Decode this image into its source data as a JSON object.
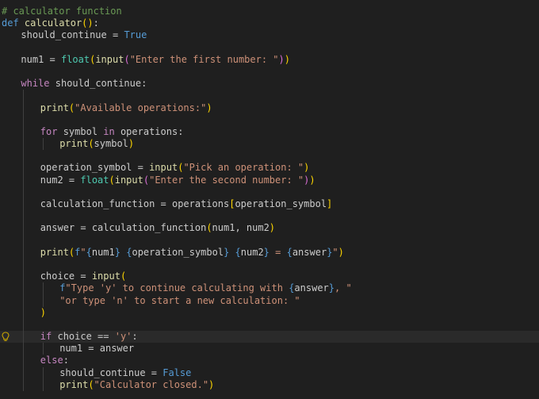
{
  "editor": {
    "background": "#1f1f1f",
    "current_line_background": "#2a2a2a",
    "indent_guide_color": "#404040",
    "lightbulb_line": 27,
    "current_line": 27,
    "lines": [
      {
        "indent": 0,
        "tokens": [
          {
            "t": "comment",
            "v": "# calculator function"
          }
        ]
      },
      {
        "indent": 0,
        "tokens": [
          {
            "t": "keyword",
            "v": "def"
          },
          {
            "t": "plain",
            "v": " "
          },
          {
            "t": "function",
            "v": "calculator"
          },
          {
            "t": "bracket1",
            "v": "()"
          },
          {
            "t": "plain",
            "v": ":"
          }
        ]
      },
      {
        "indent": 1,
        "tokens": [
          {
            "t": "plain",
            "v": "should_continue = "
          },
          {
            "t": "constant",
            "v": "True"
          }
        ]
      },
      {
        "indent": 1,
        "tokens": []
      },
      {
        "indent": 1,
        "tokens": [
          {
            "t": "plain",
            "v": "num1 = "
          },
          {
            "t": "builtin",
            "v": "float"
          },
          {
            "t": "bracket1",
            "v": "("
          },
          {
            "t": "function",
            "v": "input"
          },
          {
            "t": "bracket2",
            "v": "("
          },
          {
            "t": "string",
            "v": "\"Enter the first number: \""
          },
          {
            "t": "bracket2",
            "v": ")"
          },
          {
            "t": "bracket1",
            "v": ")"
          }
        ]
      },
      {
        "indent": 1,
        "tokens": []
      },
      {
        "indent": 1,
        "tokens": [
          {
            "t": "control",
            "v": "while"
          },
          {
            "t": "plain",
            "v": " should_continue:"
          }
        ]
      },
      {
        "indent": 2,
        "tokens": []
      },
      {
        "indent": 2,
        "tokens": [
          {
            "t": "function",
            "v": "print"
          },
          {
            "t": "bracket1",
            "v": "("
          },
          {
            "t": "string",
            "v": "\"Available operations:\""
          },
          {
            "t": "bracket1",
            "v": ")"
          }
        ]
      },
      {
        "indent": 2,
        "tokens": []
      },
      {
        "indent": 2,
        "tokens": [
          {
            "t": "control",
            "v": "for"
          },
          {
            "t": "plain",
            "v": " symbol "
          },
          {
            "t": "control",
            "v": "in"
          },
          {
            "t": "plain",
            "v": " operations:"
          }
        ]
      },
      {
        "indent": 3,
        "tokens": [
          {
            "t": "function",
            "v": "print"
          },
          {
            "t": "bracket1",
            "v": "("
          },
          {
            "t": "plain",
            "v": "symbol"
          },
          {
            "t": "bracket1",
            "v": ")"
          }
        ]
      },
      {
        "indent": 2,
        "tokens": []
      },
      {
        "indent": 2,
        "tokens": [
          {
            "t": "plain",
            "v": "operation_symbol = "
          },
          {
            "t": "function",
            "v": "input"
          },
          {
            "t": "bracket1",
            "v": "("
          },
          {
            "t": "string",
            "v": "\"Pick an operation: \""
          },
          {
            "t": "bracket1",
            "v": ")"
          }
        ]
      },
      {
        "indent": 2,
        "tokens": [
          {
            "t": "plain",
            "v": "num2 = "
          },
          {
            "t": "builtin",
            "v": "float"
          },
          {
            "t": "bracket1",
            "v": "("
          },
          {
            "t": "function",
            "v": "input"
          },
          {
            "t": "bracket2",
            "v": "("
          },
          {
            "t": "string",
            "v": "\"Enter the second number: \""
          },
          {
            "t": "bracket2",
            "v": ")"
          },
          {
            "t": "bracket1",
            "v": ")"
          }
        ]
      },
      {
        "indent": 2,
        "tokens": []
      },
      {
        "indent": 2,
        "tokens": [
          {
            "t": "plain",
            "v": "calculation_function = operations"
          },
          {
            "t": "bracket1",
            "v": "["
          },
          {
            "t": "plain",
            "v": "operation_symbol"
          },
          {
            "t": "bracket1",
            "v": "]"
          }
        ]
      },
      {
        "indent": 2,
        "tokens": []
      },
      {
        "indent": 2,
        "tokens": [
          {
            "t": "plain",
            "v": "answer = calculation_function"
          },
          {
            "t": "bracket1",
            "v": "("
          },
          {
            "t": "plain",
            "v": "num1, num2"
          },
          {
            "t": "bracket1",
            "v": ")"
          }
        ]
      },
      {
        "indent": 2,
        "tokens": []
      },
      {
        "indent": 2,
        "tokens": [
          {
            "t": "function",
            "v": "print"
          },
          {
            "t": "bracket1",
            "v": "("
          },
          {
            "t": "keyword",
            "v": "f"
          },
          {
            "t": "string",
            "v": "\""
          },
          {
            "t": "keyword",
            "v": "{"
          },
          {
            "t": "plain",
            "v": "num1"
          },
          {
            "t": "keyword",
            "v": "}"
          },
          {
            "t": "string",
            "v": " "
          },
          {
            "t": "keyword",
            "v": "{"
          },
          {
            "t": "plain",
            "v": "operation_symbol"
          },
          {
            "t": "keyword",
            "v": "}"
          },
          {
            "t": "string",
            "v": " "
          },
          {
            "t": "keyword",
            "v": "{"
          },
          {
            "t": "plain",
            "v": "num2"
          },
          {
            "t": "keyword",
            "v": "}"
          },
          {
            "t": "string",
            "v": " = "
          },
          {
            "t": "keyword",
            "v": "{"
          },
          {
            "t": "plain",
            "v": "answer"
          },
          {
            "t": "keyword",
            "v": "}"
          },
          {
            "t": "string",
            "v": "\""
          },
          {
            "t": "bracket1",
            "v": ")"
          }
        ]
      },
      {
        "indent": 2,
        "tokens": []
      },
      {
        "indent": 2,
        "tokens": [
          {
            "t": "plain",
            "v": "choice = "
          },
          {
            "t": "function",
            "v": "input"
          },
          {
            "t": "bracket1",
            "v": "("
          }
        ]
      },
      {
        "indent": 3,
        "tokens": [
          {
            "t": "keyword",
            "v": "f"
          },
          {
            "t": "string",
            "v": "\"Type 'y' to continue calculating with "
          },
          {
            "t": "keyword",
            "v": "{"
          },
          {
            "t": "plain",
            "v": "answer"
          },
          {
            "t": "keyword",
            "v": "}"
          },
          {
            "t": "string",
            "v": ", \""
          }
        ]
      },
      {
        "indent": 3,
        "tokens": [
          {
            "t": "string",
            "v": "\"or type 'n' to start a new calculation: \""
          }
        ]
      },
      {
        "indent": 2,
        "tokens": [
          {
            "t": "bracket1",
            "v": ")"
          }
        ]
      },
      {
        "indent": 2,
        "tokens": []
      },
      {
        "indent": 2,
        "tokens": [
          {
            "t": "control",
            "v": "if"
          },
          {
            "t": "plain",
            "v": " choice == "
          },
          {
            "t": "string",
            "v": "'y'"
          },
          {
            "t": "plain",
            "v": ":"
          }
        ]
      },
      {
        "indent": 3,
        "tokens": [
          {
            "t": "plain",
            "v": "num1 = answer"
          }
        ]
      },
      {
        "indent": 2,
        "tokens": [
          {
            "t": "control",
            "v": "else"
          },
          {
            "t": "plain",
            "v": ":"
          }
        ]
      },
      {
        "indent": 3,
        "tokens": [
          {
            "t": "plain",
            "v": "should_continue = "
          },
          {
            "t": "constant",
            "v": "False"
          }
        ]
      },
      {
        "indent": 3,
        "tokens": [
          {
            "t": "function",
            "v": "print"
          },
          {
            "t": "bracket1",
            "v": "("
          },
          {
            "t": "string",
            "v": "\"Calculator closed.\""
          },
          {
            "t": "bracket1",
            "v": ")"
          }
        ]
      }
    ]
  },
  "icons": {
    "lightbulb": "lightbulb-icon"
  }
}
